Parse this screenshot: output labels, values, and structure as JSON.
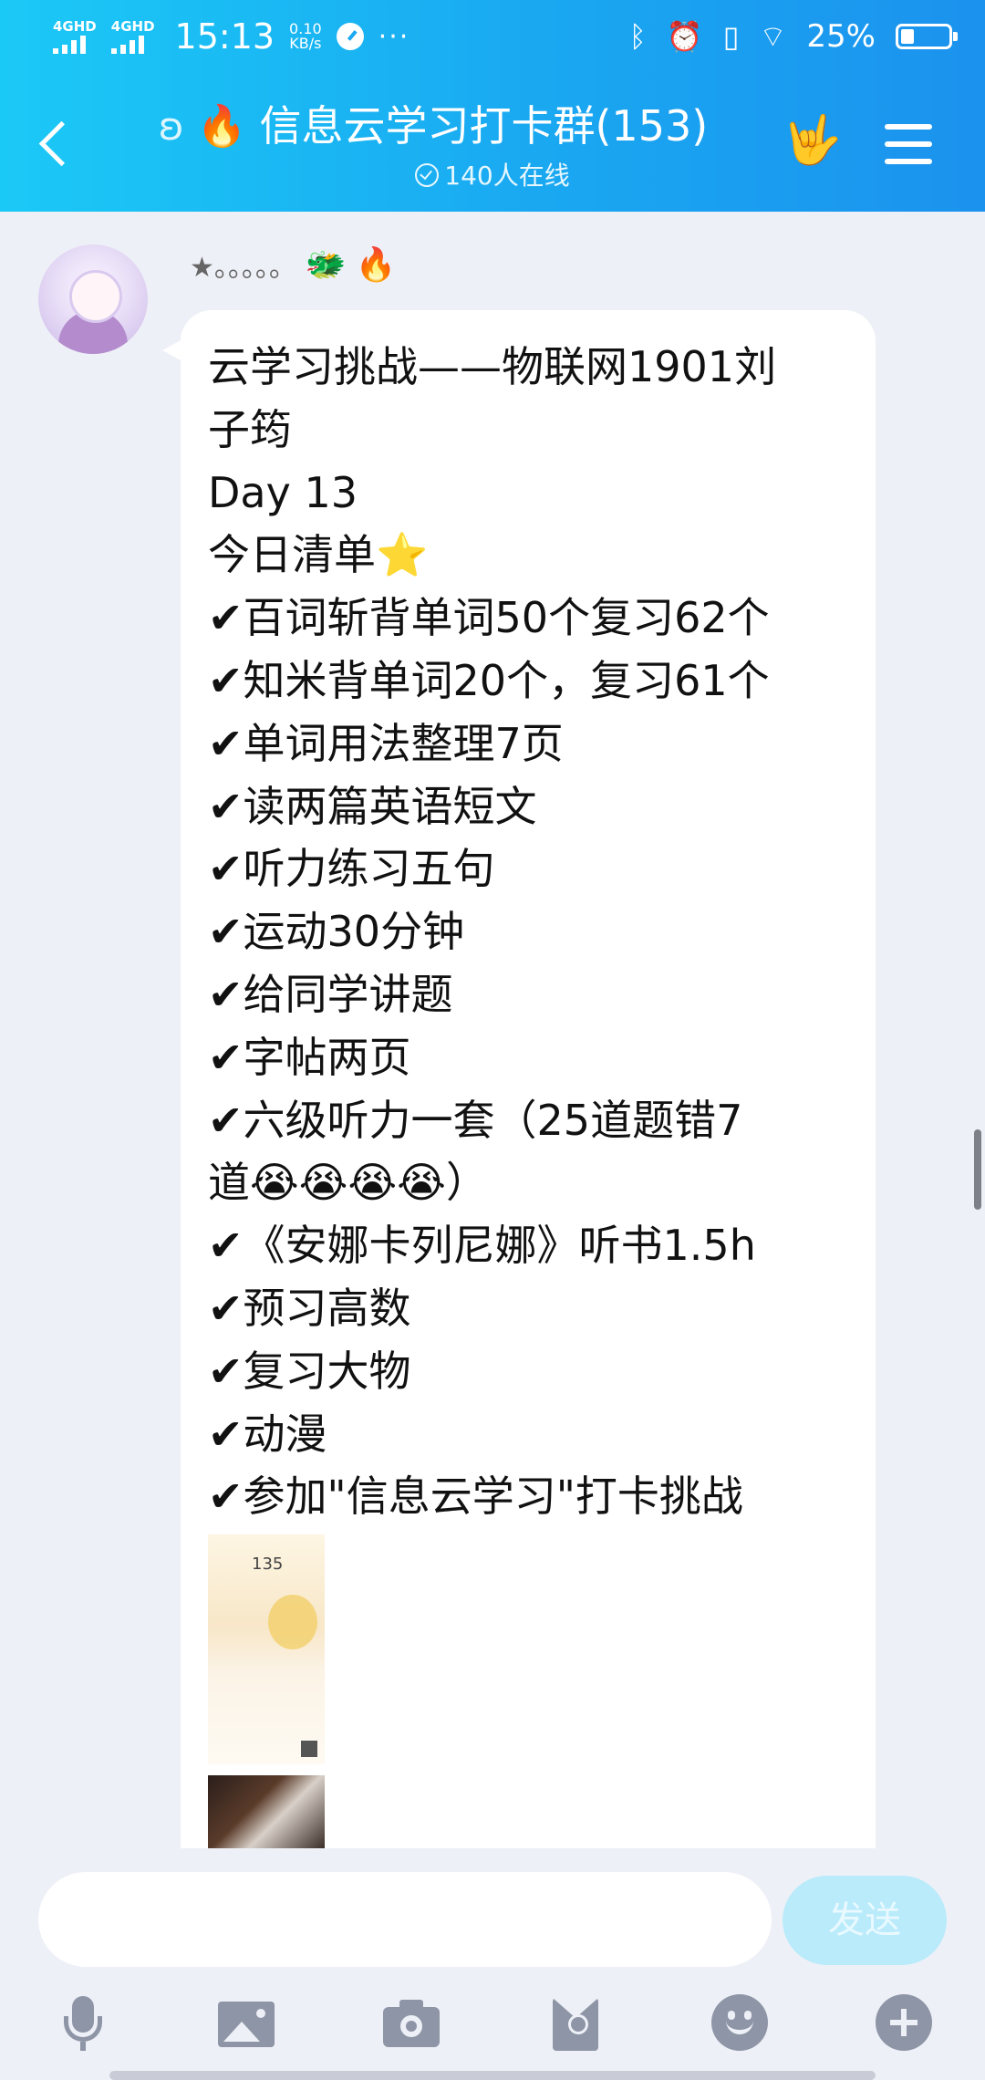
{
  "status_bar": {
    "network1": "4GHD",
    "network2": "4GHD",
    "time": "15:13",
    "speed_value": "0.10",
    "speed_unit": "KB/s",
    "more": "···",
    "battery": "25%"
  },
  "header": {
    "title": "信息云学习打卡群(153)",
    "online": "140人在线"
  },
  "message": {
    "sender": "★。。。。。",
    "lines": [
      "云学习挑战——物联网1901刘",
      "子筠",
      "Day 13",
      "今日清单⭐",
      "✔百词斩背单词50个复习62个",
      "✔知米背单词20个，复习61个",
      "✔单词用法整理7页",
      "✔读两篇英语短文",
      "✔听力练习五句",
      "✔运动30分钟",
      "✔给同学讲题",
      "✔字帖两页",
      "✔六级听力一套（25道题错7",
      "道😭😭😭😭）",
      "✔《安娜卡列尼娜》听书1.5h",
      "✔预习高数",
      "✔复习大物",
      "✔动漫",
      "✔参加\"信息云学习\"打卡挑战"
    ],
    "thumb_text": "135"
  },
  "input": {
    "placeholder": "",
    "send_label": "发送"
  },
  "toolbar": {
    "icons": [
      "mic-icon",
      "image-icon",
      "camera-icon",
      "red-envelope-icon",
      "emoji-icon",
      "plus-icon"
    ]
  },
  "colors": {
    "header_start": "#1bc9f6",
    "header_end": "#1b92ee",
    "send_button": "#b9ebfb",
    "background": "#eef0f7"
  }
}
